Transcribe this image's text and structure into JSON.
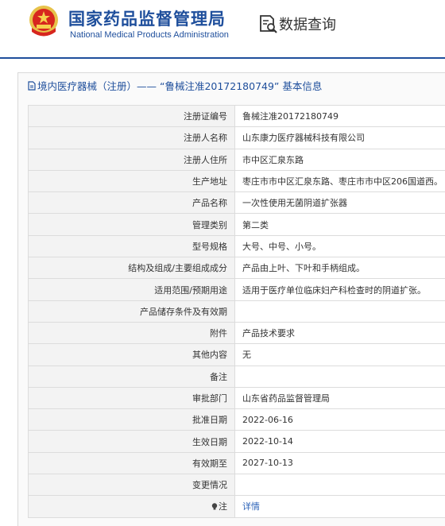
{
  "header": {
    "site_name_cn": "国家药品监督管理局",
    "site_name_en": "National Medical Products Administration",
    "query_label": "数据查询",
    "brand_color": "#1f4f9c"
  },
  "panel": {
    "title": "境内医疗器械（注册）——  “鲁械注准20172180749”  基本信息"
  },
  "rows": [
    {
      "label": "注册证编号",
      "value": "鲁械注准20172180749"
    },
    {
      "label": "注册人名称",
      "value": "山东康力医疗器械科技有限公司"
    },
    {
      "label": "注册人住所",
      "value": "市中区汇泉东路"
    },
    {
      "label": "生产地址",
      "value": "枣庄市市中区汇泉东路、枣庄市市中区206国道西。"
    },
    {
      "label": "产品名称",
      "value": "一次性使用无菌阴道扩张器"
    },
    {
      "label": "管理类别",
      "value": "第二类"
    },
    {
      "label": "型号规格",
      "value": "大号、中号、小号。"
    },
    {
      "label": "结构及组成/主要组成成分",
      "value": "产品由上叶、下叶和手柄组成。"
    },
    {
      "label": "适用范围/预期用途",
      "value": "适用于医疗单位临床妇产科检查时的阴道扩张。"
    },
    {
      "label": "产品储存条件及有效期",
      "value": ""
    },
    {
      "label": "附件",
      "value": "产品技术要求"
    },
    {
      "label": "其他内容",
      "value": "无"
    },
    {
      "label": "备注",
      "value": ""
    },
    {
      "label": "审批部门",
      "value": "山东省药品监督管理局"
    },
    {
      "label": "批准日期",
      "value": "2022-06-16"
    },
    {
      "label": "生效日期",
      "value": "2022-10-14"
    },
    {
      "label": "有效期至",
      "value": "2027-10-13"
    },
    {
      "label": "变更情况",
      "value": ""
    }
  ],
  "note_row": {
    "label": "注",
    "link_text": "详情",
    "icon": "lightbulb-icon"
  }
}
